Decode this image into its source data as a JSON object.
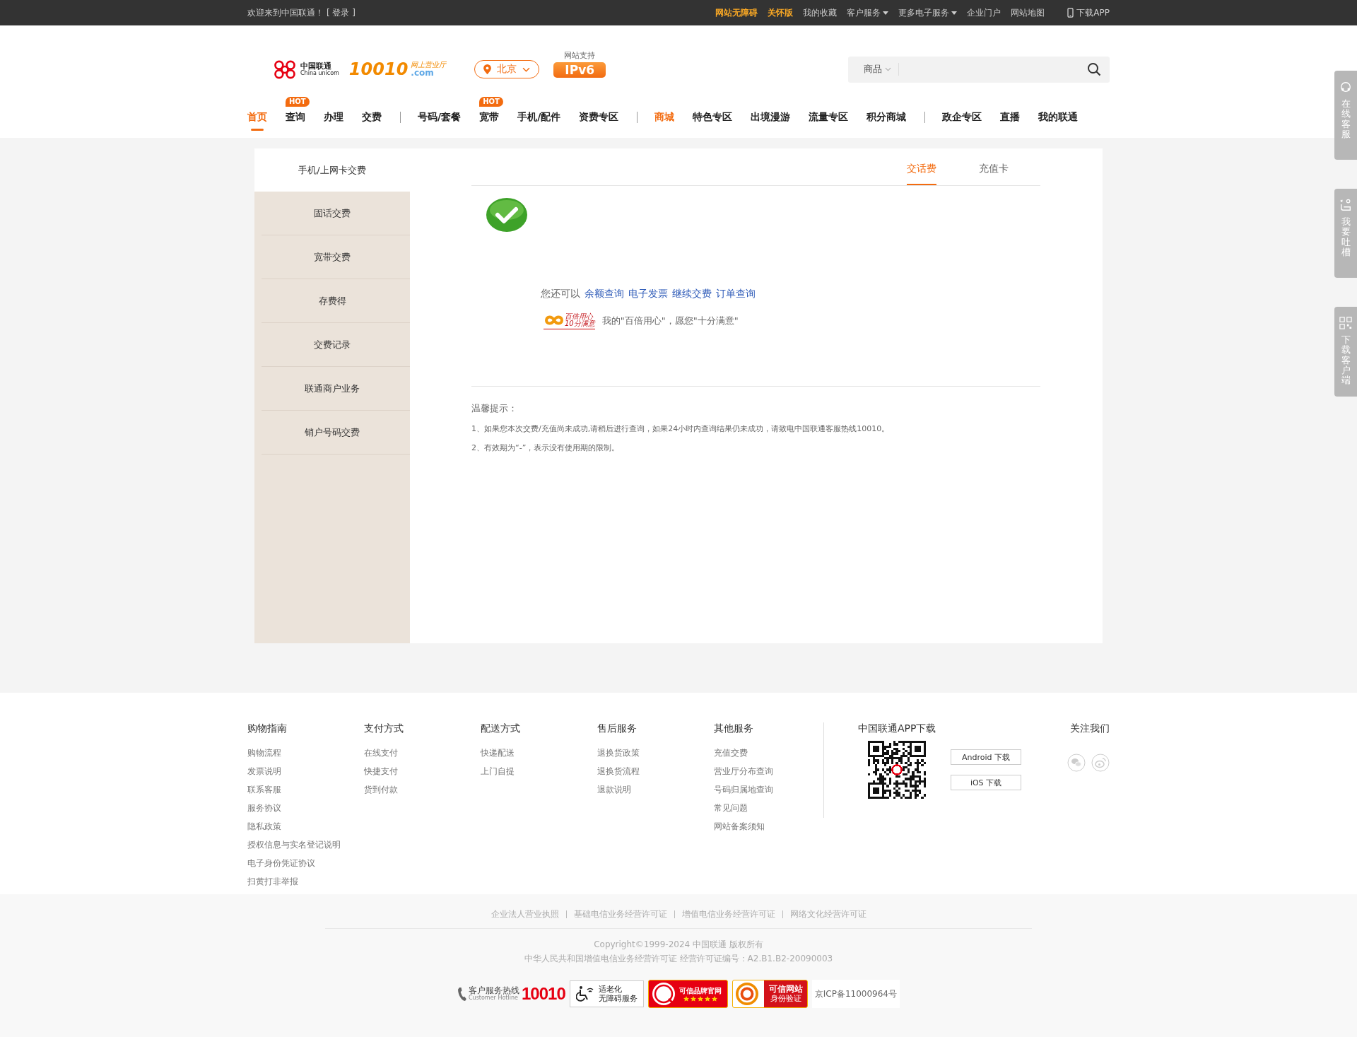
{
  "top_bar": {
    "welcome": "欢迎来到中国联通！",
    "login": "[ 登录 ]",
    "links": [
      {
        "label": "网站无障碍",
        "highlight": true,
        "dropdown": false
      },
      {
        "label": "关怀版",
        "highlight": true,
        "dropdown": false
      },
      {
        "label": "我的收藏",
        "highlight": false,
        "dropdown": false
      },
      {
        "label": "客户服务",
        "highlight": false,
        "dropdown": true
      },
      {
        "label": "更多电子服务",
        "highlight": false,
        "dropdown": true
      },
      {
        "label": "企业门户",
        "highlight": false,
        "dropdown": false
      },
      {
        "label": "网站地图",
        "highlight": false,
        "dropdown": false
      }
    ],
    "app": "下载APP"
  },
  "header": {
    "logo": {
      "brand": "中国联通",
      "brand_en": "China unicom",
      "number": "10010",
      "tagline": "网上营业厅",
      "domain": ".com"
    },
    "city": "北京",
    "ipv6": {
      "caption": "网站支持",
      "label": "IPv6"
    },
    "search": {
      "category": "商品"
    }
  },
  "nav": [
    [
      {
        "label": "首页",
        "selected": true
      },
      {
        "label": "查询",
        "selected": false,
        "badge": "HOT"
      },
      {
        "label": "办理",
        "selected": false
      },
      {
        "label": "交费",
        "selected": false
      }
    ],
    [
      {
        "label": "号码/套餐",
        "selected": false
      },
      {
        "label": "宽带",
        "selected": false,
        "badge": "HOT"
      },
      {
        "label": "手机/配件",
        "selected": false
      },
      {
        "label": "资费专区",
        "selected": false
      }
    ],
    [
      {
        "label": "商城",
        "selected": false,
        "highlight": true
      },
      {
        "label": "特色专区",
        "selected": false
      },
      {
        "label": "出境漫游",
        "selected": false
      },
      {
        "label": "流量专区",
        "selected": false
      },
      {
        "label": "积分商城",
        "selected": false
      }
    ],
    [
      {
        "label": "政企专区",
        "selected": false
      },
      {
        "label": "直播",
        "selected": false
      },
      {
        "label": "我的联通",
        "selected": false
      }
    ]
  ],
  "sidebar": {
    "items": [
      {
        "label": "手机/上网卡交费",
        "selected": true
      },
      {
        "label": "固话交费",
        "selected": false
      },
      {
        "label": "宽带交费",
        "selected": false
      },
      {
        "label": "存费得",
        "selected": false
      },
      {
        "label": "交费记录",
        "selected": false
      },
      {
        "label": "联通商户业务",
        "selected": false
      },
      {
        "label": "销户号码交费",
        "selected": false
      }
    ]
  },
  "tabs": [
    {
      "label": "交话费",
      "selected": true
    },
    {
      "label": "充值卡",
      "selected": false
    }
  ],
  "result": {
    "prompt": "您还可以",
    "links": [
      "余额查询",
      "电子发票",
      "继续交费",
      "订单查询"
    ],
    "slogan_logo": {
      "line1": "百倍用心",
      "line2": "10分满意"
    },
    "slogan": "我的\"百倍用心\"，愿您\"十分满意\""
  },
  "tips": {
    "title": "温馨提示：",
    "items": [
      "1、如果您本次交费/充值尚未成功,请稍后进行查询，如果24小时内查询结果仍未成功，请致电中国联通客服热线10010。",
      "2、有效期为“-”，表示没有使用期的限制。"
    ]
  },
  "footer": {
    "columns": [
      {
        "title": "购物指南",
        "links": [
          "购物流程",
          "发票说明",
          "联系客服",
          "服务协议",
          "隐私政策",
          "授权信息与实名登记说明",
          "电子身份凭证协议",
          "扫黄打非举报"
        ]
      },
      {
        "title": "支付方式",
        "links": [
          "在线支付",
          "快捷支付",
          "货到付款"
        ]
      },
      {
        "title": "配送方式",
        "links": [
          "快递配送",
          "上门自提"
        ]
      },
      {
        "title": "售后服务",
        "links": [
          "退换货政策",
          "退换货流程",
          "退款说明"
        ]
      },
      {
        "title": "其他服务",
        "links": [
          "充值交费",
          "营业厅分布查询",
          "号码归属地查询",
          "常见问题",
          "网站备案须知"
        ]
      }
    ],
    "app": {
      "title": "中国联通APP下载",
      "buttons": [
        "Android 下载",
        "iOS 下载"
      ]
    },
    "follow": {
      "title": "关注我们"
    }
  },
  "bottom": {
    "licenses": [
      "企业法人营业执照",
      "基础电信业务经营许可证",
      "增值电信业务经营许可证",
      "网络文化经营许可证"
    ],
    "copyright": "Copyright©1999-2024  中国联通  版权所有",
    "license_no": "中华人民共和国增值电信业务经营许可证 经营许可证编号：A2.B1.B2-20090003",
    "hotline": {
      "label": "客户服务热线",
      "label_en": "Customer Hotline",
      "number": "10010"
    },
    "elder": {
      "line1": "适老化",
      "line2": "无障碍服务"
    },
    "brand": {
      "label": "可信品牌官网",
      "stars": 5
    },
    "trusted": {
      "label": "可信网站",
      "sub": "身份验证"
    },
    "icp": "京ICP备11000964号"
  },
  "side_tabs": [
    {
      "kind": "service",
      "label": "在线客服"
    },
    {
      "kind": "feedback",
      "label": "我要吐槽"
    },
    {
      "kind": "download",
      "label": "下载客户端"
    }
  ]
}
